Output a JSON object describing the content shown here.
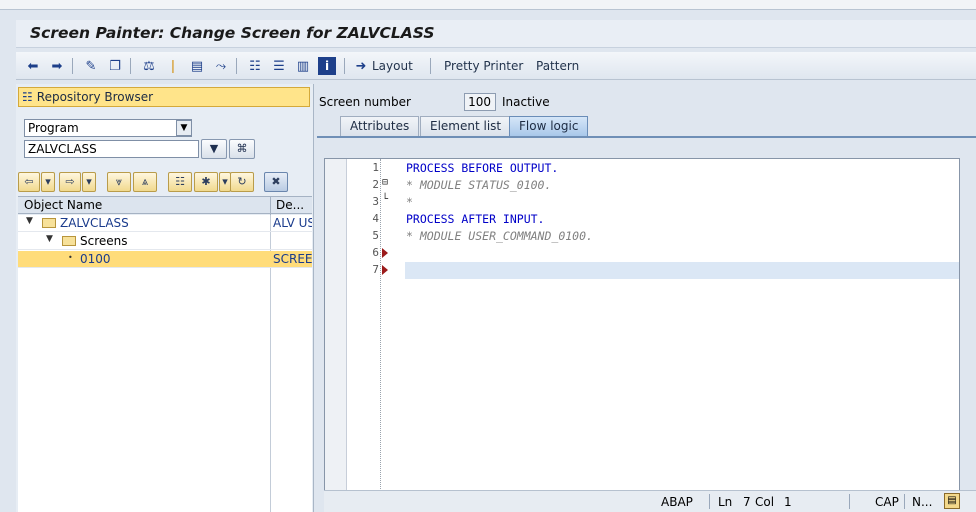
{
  "window": {
    "title": "Screen Painter: Change Screen for ZALVCLASS"
  },
  "toolbar": {
    "layout_label": "Layout",
    "pretty_printer_label": "Pretty Printer",
    "pattern_label": "Pattern"
  },
  "repository": {
    "header": "Repository Browser",
    "object_type": "Program",
    "object_name": "ZALVCLASS",
    "columns": {
      "name": "Object Name",
      "desc": "De..."
    },
    "tree": [
      {
        "label": "ZALVCLASS",
        "desc": "ALV US"
      },
      {
        "label": "Screens",
        "desc": ""
      },
      {
        "label": "0100",
        "desc": "SCREEN"
      }
    ]
  },
  "screen": {
    "number_label": "Screen number",
    "number": "100",
    "status": "Inactive"
  },
  "tabs": [
    {
      "label": "Attributes",
      "active": false
    },
    {
      "label": "Element list",
      "active": false
    },
    {
      "label": "Flow logic",
      "active": true
    }
  ],
  "editor": {
    "lines": [
      {
        "n": "1",
        "text": "PROCESS BEFORE OUTPUT."
      },
      {
        "n": "2",
        "text": "* MODULE STATUS_0100."
      },
      {
        "n": "3",
        "text": "*"
      },
      {
        "n": "4",
        "text": "PROCESS AFTER INPUT."
      },
      {
        "n": "5",
        "text": "* MODULE USER_COMMAND_0100."
      },
      {
        "n": "6",
        "text": ""
      },
      {
        "n": "7",
        "text": ""
      }
    ]
  },
  "statusbar": {
    "language": "ABAP",
    "ln_label": "Ln",
    "ln_value": "7",
    "col_label": "Col",
    "col_value": "1",
    "caps": "CAP",
    "num": "N..."
  },
  "colors": {
    "accent_selected": "#ffdc7a",
    "keyword": "#0000c8",
    "comment": "#808080"
  }
}
